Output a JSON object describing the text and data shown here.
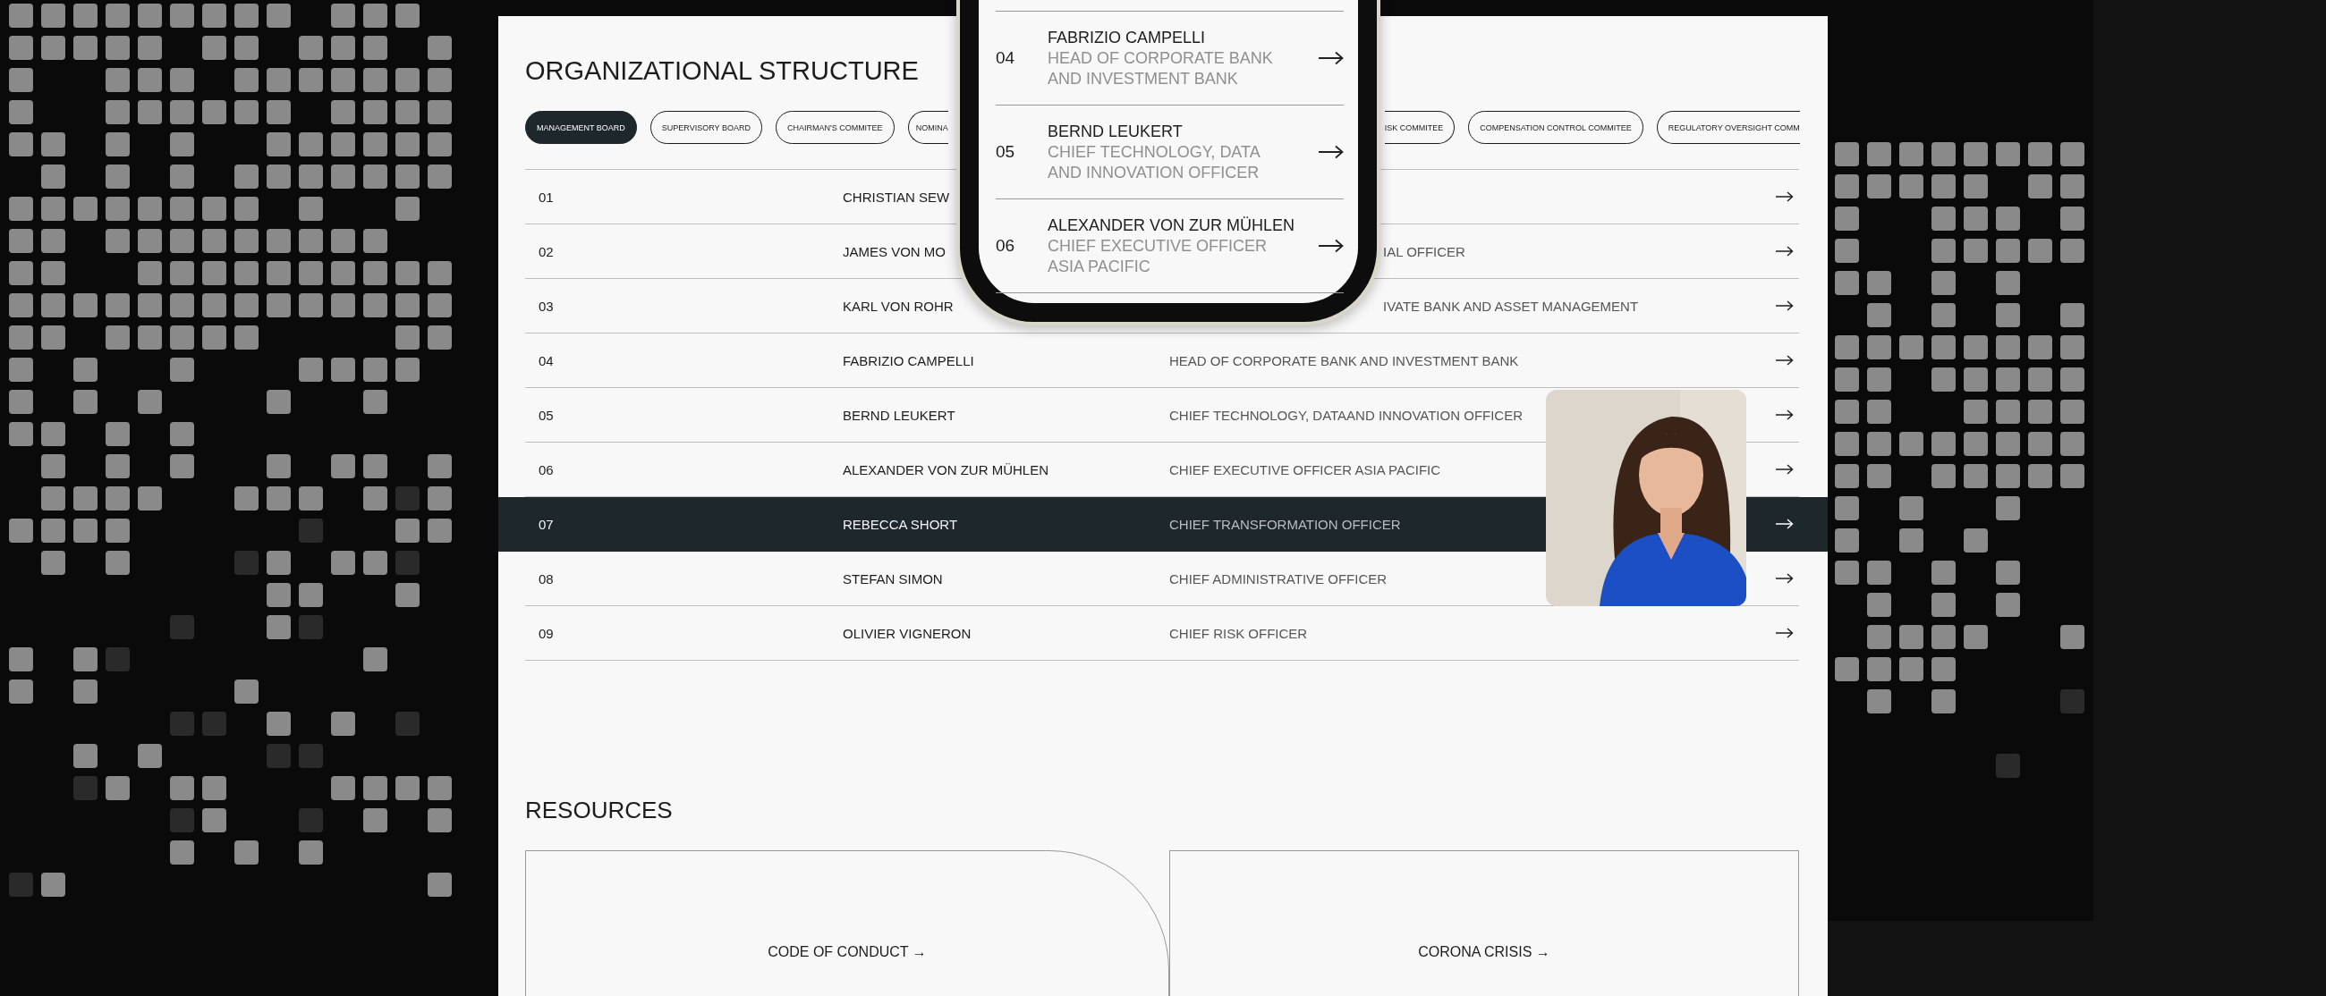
{
  "title": "ORGANIZATIONAL STRUCTURE",
  "tabs": [
    {
      "label": "MANAGEMENT BOARD",
      "selected": true,
      "kind": "full"
    },
    {
      "label": "SUPERVISORY BOARD",
      "selected": false,
      "kind": "full"
    },
    {
      "label": "CHAIRMAN'S COMMITEE",
      "selected": false,
      "kind": "full"
    },
    {
      "label": "NOMINA",
      "selected": false,
      "kind": "cut-right"
    },
    {
      "label": "ISK COMMITEE",
      "selected": false,
      "kind": "cut-left"
    },
    {
      "label": "COMPENSATION CONTROL COMMITEE",
      "selected": false,
      "kind": "full"
    },
    {
      "label": "REGULATORY OVERSIGHT COMM",
      "selected": false,
      "kind": "cut-right"
    }
  ],
  "rows": [
    {
      "number": "01",
      "name": "CHRISTIAN SEW",
      "selected": false
    },
    {
      "number": "02",
      "name": "JAMES VON MO",
      "role": "IAL OFFICER",
      "role_cut": true,
      "selected": false
    },
    {
      "number": "03",
      "name": "KARL VON ROHR",
      "role": "IVATE BANK AND ASSET MANAGEMENT",
      "role_cut": true,
      "selected": false
    },
    {
      "number": "04",
      "name": "FABRIZIO CAMPELLI",
      "role": "HEAD OF CORPORATE BANK AND INVESTMENT BANK",
      "selected": false
    },
    {
      "number": "05",
      "name": "BERND LEUKERT",
      "role": "CHIEF TECHNOLOGY, DATAAND INNOVATION OFFICER",
      "selected": false
    },
    {
      "number": "06",
      "name": "ALEXANDER VON ZUR MÜHLEN",
      "role": "CHIEF EXECUTIVE OFFICER ASIA PACIFIC",
      "selected": false
    },
    {
      "number": "07",
      "name": "REBECCA SHORT",
      "role": "CHIEF TRANSFORMATION OFFICER",
      "selected": true
    },
    {
      "number": "08",
      "name": "STEFAN SIMON",
      "role": "CHIEF ADMINISTRATIVE OFFICER",
      "selected": false
    },
    {
      "number": "09",
      "name": "OLIVIER VIGNERON",
      "role": "CHIEF RISK OFFICER",
      "selected": false
    }
  ],
  "phone": {
    "rows": [
      {
        "number": "04",
        "name": "FABRIZIO CAMPELLI",
        "role": "HEAD OF CORPORATE BANK AND INVESTMENT BANK"
      },
      {
        "number": "05",
        "name": "BERND LEUKERT",
        "role": "CHIEF TECHNOLOGY, DATA AND INNOVATION OFFICER"
      },
      {
        "number": "06",
        "name": "ALEXANDER VON ZUR MÜHLEN",
        "role": "CHIEF EXECUTIVE OFFICER ASIA PACIFIC"
      }
    ]
  },
  "resources": {
    "title": "RESOURCES",
    "cards": [
      {
        "label": "CODE OF CONDUCT →",
        "kind": "rounded"
      },
      {
        "label": "CORONA CRISIS →",
        "kind": "square"
      }
    ]
  }
}
